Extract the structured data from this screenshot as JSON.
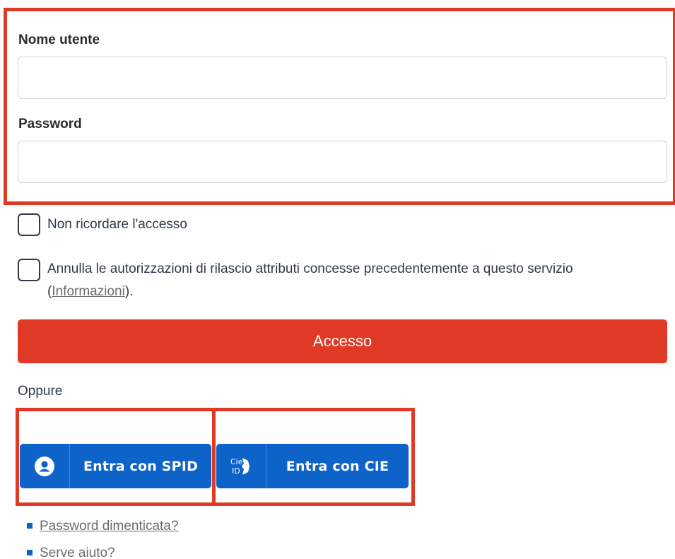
{
  "form": {
    "username_label": "Nome utente",
    "username_value": "",
    "password_label": "Password",
    "password_value": ""
  },
  "options": {
    "no_remember_label": "Non ricordare l'accesso",
    "revoke_label": "Annulla le autorizzazioni di rilascio attributi concesse precedentemente a questo servizio",
    "revoke_open_paren": "(",
    "revoke_link": "Informazioni",
    "revoke_close": ")."
  },
  "actions": {
    "login_label": "Accesso",
    "or_label": "Oppure",
    "spid_label": "Entra con SPID",
    "cie_label": "Entra con CIE",
    "cie_icon_text_top": "Cie",
    "cie_icon_text_bottom": "ID"
  },
  "help": {
    "forgot_password": "Password dimenticata?",
    "need_help": "Serve aiuto?"
  },
  "colors": {
    "accent_red": "#e03a26",
    "id_blue": "#0d63c8"
  },
  "icons": [
    "user-circle-icon",
    "cie-id-icon"
  ]
}
